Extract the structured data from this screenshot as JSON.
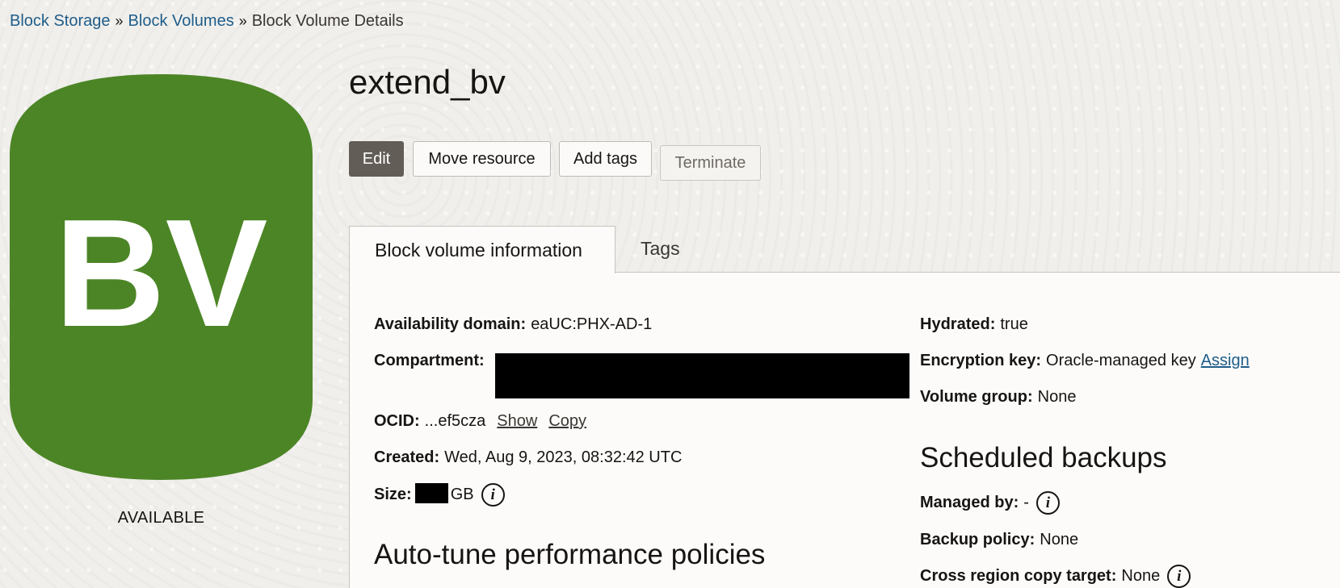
{
  "breadcrumb": {
    "items": [
      "Block Storage",
      "Block Volumes"
    ],
    "separator": "»",
    "current": "Block Volume Details"
  },
  "badge": {
    "text": "BV",
    "color": "#4c8526",
    "text_color": "#ffffff",
    "status": "AVAILABLE"
  },
  "title": "extend_bv",
  "actions": {
    "edit": "Edit",
    "move": "Move resource",
    "add_tags": "Add tags",
    "terminate": "Terminate"
  },
  "tabs": {
    "info": "Block volume information",
    "tags": "Tags"
  },
  "details": {
    "availability_domain": {
      "label": "Availability domain:",
      "value": "eaUC:PHX-AD-1"
    },
    "compartment": {
      "label": "Compartment:"
    },
    "ocid": {
      "label": "OCID:",
      "value": "...ef5cza",
      "show": "Show",
      "copy": "Copy"
    },
    "created": {
      "label": "Created:",
      "value": "Wed, Aug 9, 2023, 08:32:42 UTC"
    },
    "size": {
      "label": "Size:",
      "unit": "GB"
    },
    "autotune_heading": "Auto-tune performance policies",
    "hydrated": {
      "label": "Hydrated:",
      "value": "true"
    },
    "encryption_key": {
      "label": "Encryption key:",
      "value": "Oracle-managed key",
      "action": "Assign"
    },
    "volume_group": {
      "label": "Volume group:",
      "value": "None"
    },
    "scheduled_backups_heading": "Scheduled backups",
    "managed_by": {
      "label": "Managed by:",
      "value": "-"
    },
    "backup_policy": {
      "label": "Backup policy:",
      "value": "None"
    },
    "cross_region": {
      "label": "Cross region copy target:",
      "value": "None"
    }
  },
  "icons": {
    "info": "info-icon"
  }
}
